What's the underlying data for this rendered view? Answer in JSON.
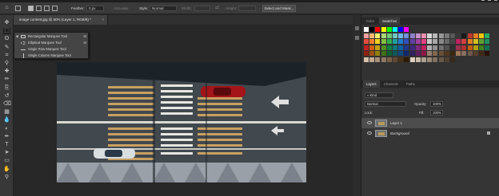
{
  "options_bar": {
    "feather_label": "Feather:",
    "feather_value": "0 px",
    "anti_alias_label": "Anti-alias",
    "style_label": "Style:",
    "style_value": "Normal",
    "width_label": "Width:",
    "height_label": "Height:",
    "select_mask_button": "Select and Mask..."
  },
  "document": {
    "tab_title": "image content.jpg @ 50% (Layer 1, RGB/8) *",
    "close_glyph": "×"
  },
  "tool_flyout": {
    "items": [
      {
        "label": "Rectangular Marquee Tool",
        "key": "M",
        "selected": true,
        "icon": "rectangle-marquee-icon"
      },
      {
        "label": "Elliptical Marquee Tool",
        "key": "M",
        "selected": false,
        "icon": "ellipse-marquee-icon"
      },
      {
        "label": "Single Row Marquee Tool",
        "key": "",
        "selected": false,
        "icon": "single-row-marquee-icon"
      },
      {
        "label": "Single Column Marquee Tool",
        "key": "",
        "selected": false,
        "icon": "single-column-marquee-icon"
      }
    ],
    "selected_mark": "■"
  },
  "toolbar": {
    "tools": [
      "move-tool-icon",
      "marquee-tool-icon",
      "lasso-tool-icon",
      "quick-select-tool-icon",
      "crop-tool-icon",
      "eyedropper-tool-icon",
      "healing-brush-icon",
      "brush-tool-icon",
      "clone-stamp-icon",
      "history-brush-icon",
      "eraser-tool-icon",
      "gradient-tool-icon",
      "blur-tool-icon",
      "dodge-tool-icon",
      "pen-tool-icon",
      "type-tool-icon",
      "path-select-icon",
      "shape-tool-icon",
      "hand-tool-icon",
      "zoom-tool-icon"
    ]
  },
  "color_panel": {
    "tabs": [
      "Color",
      "Swatches"
    ],
    "active_tab": "Swatches",
    "swatch_rows": [
      [
        "#ffffff",
        "#000000",
        "#ff0000",
        "#ffff00",
        "#00ff00",
        "#00ffff",
        "#0000ff",
        "#ff00ff"
      ],
      [
        "#f4a0a0",
        "#f8b878",
        "#f8f070",
        "#a8d878",
        "#70c878",
        "#70c8c0",
        "#70b8e8",
        "#7090d8",
        "#9080c8",
        "#c890c8",
        "#f090b0",
        "#d8d8d8",
        "#b8b8b8",
        "#989898",
        "#787878",
        "#585858",
        "#383838",
        "#181818",
        "#c0392b",
        "#e67e22",
        "#f1c40f",
        "#27ae60"
      ],
      [
        "#e74c3c",
        "#f08030",
        "#f0d020",
        "#80c040",
        "#30b050",
        "#20a0a0",
        "#2080d0",
        "#3050c0",
        "#6040a0",
        "#a040a0",
        "#e04080",
        "#c8c8c8",
        "#a8a8a8",
        "#888888",
        "#686868",
        "#484848",
        "#c02060",
        "#d04040",
        "#e08020",
        "#d0c020",
        "#60a030",
        "#209060"
      ],
      [
        "#c02020",
        "#d06010",
        "#c0a010",
        "#509020",
        "#108040",
        "#107878",
        "#1060a8",
        "#203890",
        "#402880",
        "#802880",
        "#c02060",
        "#b0b0b0",
        "#909090",
        "#707070",
        "#505050",
        "#303030",
        "#a03050",
        "#b03030",
        "#c06010",
        "#b0a010",
        "#408020",
        "#107050"
      ],
      [
        "#902010",
        "#a05010",
        "#908010",
        "#407010",
        "#106030",
        "#105858",
        "#104880",
        "#102870",
        "#302060",
        "#602060",
        "#901848",
        "#988070",
        "#806850",
        "#685038",
        "#503820",
        "#382810",
        "#a07858",
        "#887060",
        "#705848",
        "#584030",
        "#402818",
        "#281008"
      ],
      [
        "#d8c0a8",
        "#c0a890",
        "#a89078",
        "#907860",
        "#786048",
        "#604830",
        "#483018",
        "#301800",
        "#e0d0c0",
        "#c8b8a8",
        "#b0a090",
        "#988878",
        "#807060",
        "#685848",
        "#504030",
        "#382818"
      ]
    ]
  },
  "layers_panel": {
    "tabs": [
      "Layers",
      "Channels",
      "Paths"
    ],
    "active_tab": "Layers",
    "kind_label": "Kind",
    "blend_mode": "Normal",
    "opacity_label": "Opacity:",
    "opacity_value": "100%",
    "lock_label": "Lock:",
    "fill_label": "Fill:",
    "fill_value": "100%",
    "layers": [
      {
        "name": "Layer 1",
        "selected": true,
        "italic": false,
        "locked": false
      },
      {
        "name": "Background",
        "selected": false,
        "italic": true,
        "locked": true
      }
    ]
  }
}
